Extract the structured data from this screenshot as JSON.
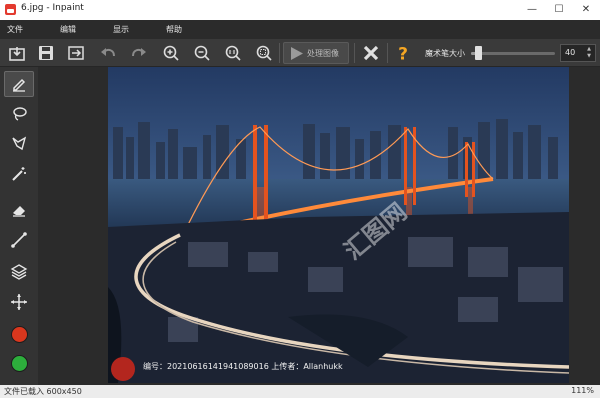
{
  "window": {
    "title": "6.jpg - Inpaint",
    "minimize": "—",
    "maximize": "☐",
    "close": "✕"
  },
  "menu": {
    "items": [
      {
        "label": "文件"
      },
      {
        "label": "编辑"
      },
      {
        "label": "显示"
      },
      {
        "label": "帮助"
      }
    ]
  },
  "toolbar": {
    "icons": [
      "open-icon",
      "save-icon",
      "save-as-icon",
      "undo-icon",
      "redo-icon",
      "zoom-in-icon",
      "zoom-out-icon",
      "zoom-actual-icon",
      "zoom-fit-icon"
    ],
    "process_label": "处理图像",
    "brush_label": "魔术笔大小",
    "brush_size": "40",
    "brush_size_value": 40,
    "brush_size_fraction": 0.08
  },
  "tools": [
    {
      "name": "marker-tool",
      "icon": "marker-icon",
      "active": true
    },
    {
      "name": "lasso-tool",
      "icon": "lasso-icon"
    },
    {
      "name": "polygon-lasso-tool",
      "icon": "polygon-lasso-icon"
    },
    {
      "name": "magic-wand-tool",
      "icon": "magic-wand-icon"
    },
    {
      "name": "eraser-tool",
      "icon": "eraser-icon"
    },
    {
      "name": "line-tool",
      "icon": "line-icon"
    },
    {
      "name": "layers-tool",
      "icon": "layers-icon"
    },
    {
      "name": "move-tool",
      "icon": "move-icon"
    },
    {
      "name": "red-marker-color",
      "color": "#d9371e"
    },
    {
      "name": "green-marker-color",
      "color": "#2dae3c"
    }
  ],
  "image": {
    "watermark_text": "编号：20210616141941089016  上传者：Allanhukk"
  },
  "status": {
    "left": "文件已载入 600x450",
    "zoom": "111%"
  },
  "colors": {
    "accent_orange": "#f5a623",
    "close_x": "#e0e0e0",
    "bridge_red": "#e4531f"
  }
}
